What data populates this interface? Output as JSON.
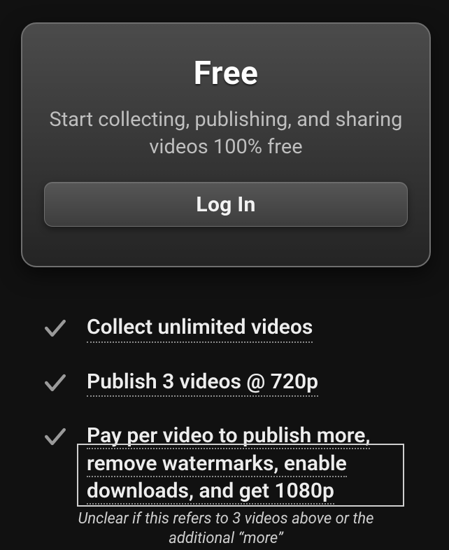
{
  "card": {
    "title": "Free",
    "subtitle": "Start collecting, publishing, and sharing videos 100% free",
    "login_label": "Log In"
  },
  "features": [
    "Collect unlimited videos",
    "Publish 3 videos @ 720p",
    "Pay per video to publish more, remove watermarks, enable downloads, and get 1080p"
  ],
  "annotation": "Unclear if this refers to 3 videos above or the additional “more”"
}
